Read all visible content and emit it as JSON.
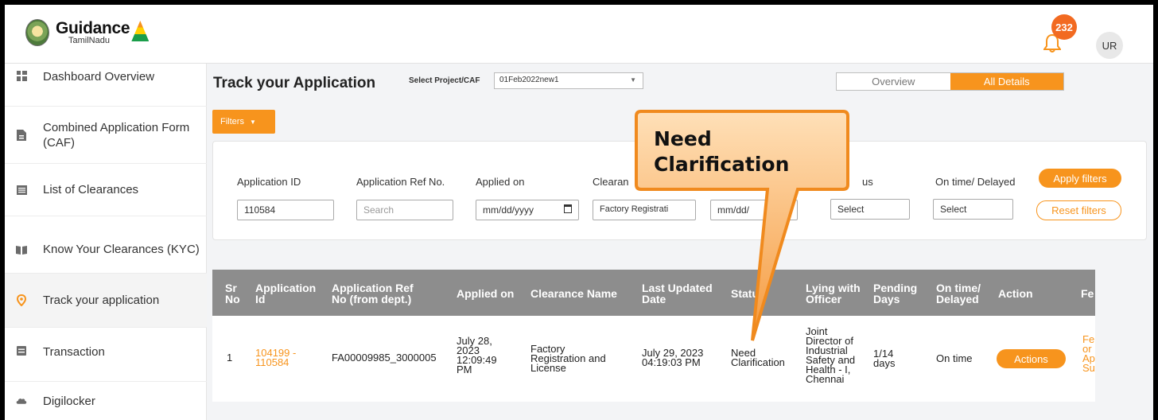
{
  "header": {
    "logo_main": "Guidance",
    "logo_sub": "TamilNadu",
    "notification_count": "232",
    "user_initials": "UR"
  },
  "sidebar": {
    "items": [
      {
        "label": "Dashboard Overview",
        "icon": "grid-icon"
      },
      {
        "label": "Combined Application Form (CAF)",
        "icon": "document-icon"
      },
      {
        "label": "List of Clearances",
        "icon": "list-icon"
      },
      {
        "label": "Know Your Clearances (KYC)",
        "icon": "book-icon"
      },
      {
        "label": "Track your application",
        "icon": "location-pin-icon",
        "active": true
      },
      {
        "label": "Transaction",
        "icon": "transaction-icon"
      },
      {
        "label": "Digilocker",
        "icon": "cloud-icon"
      }
    ]
  },
  "page": {
    "title": "Track your Application",
    "project_label": "Select Project/CAF",
    "project_value": "01Feb2022new1",
    "toggle_overview": "Overview",
    "toggle_all_details": "All Details",
    "filters_label": "Filters"
  },
  "filters": {
    "application_id_label": "Application ID",
    "application_id_value": "110584",
    "ref_no_label": "Application Ref No.",
    "ref_no_placeholder": "Search",
    "applied_on_label": "Applied on",
    "applied_on_placeholder": "mm/dd/yyyy",
    "clearance_label": "Clearan",
    "clearance_value": "Factory Registrati",
    "date2_placeholder": "mm/dd/",
    "status_label": "us",
    "status_value": "Select",
    "ontime_label": "On time/ Delayed",
    "ontime_value": "Select",
    "apply_label": "Apply filters",
    "reset_label": "Reset filters"
  },
  "table": {
    "headers": {
      "sr": "Sr\nNo",
      "app_id": "Application\nId",
      "ref_no": "Application Ref\nNo (from dept.)",
      "applied_on": "Applied on",
      "clearance": "Clearance Name",
      "last_updated": "Last Updated\nDate",
      "status": "Statu",
      "lying": "Lying with\nOfficer",
      "pending": "Pending\nDays",
      "ontime": "On time/\nDelayed",
      "action": "Action",
      "fe": "Fe"
    },
    "row": {
      "sr": "1",
      "app_id": "104199 -\n110584",
      "ref_no": "FA00009985_3000005",
      "applied_on": "July 28,\n2023\n12:09:49\nPM",
      "clearance": "Factory\nRegistration and\nLicense",
      "last_updated": "July 29, 2023\n04:19:03 PM",
      "status": "Need\nClarification",
      "lying": "Joint\nDirector of\nIndustrial\nSafety and\nHealth - I,\nChennai",
      "pending": "1/14\ndays",
      "ontime": "On time",
      "action_label": "Actions",
      "fe": "Fe\nor\nAp\nSu"
    }
  },
  "callout": {
    "text": "Need Clarification"
  }
}
